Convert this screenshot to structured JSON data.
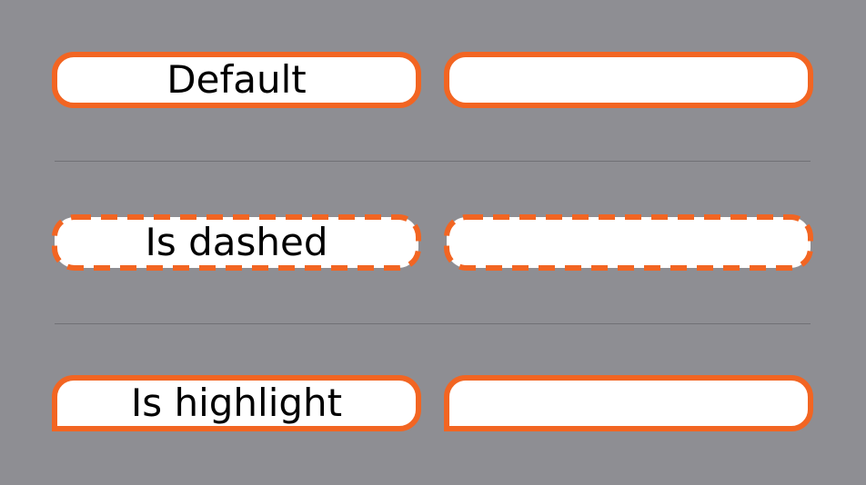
{
  "theme": {
    "background": "#8e8e93",
    "accent": "#f26522",
    "button_fill": "#ffffff",
    "text": "#000000",
    "divider": "#707075"
  },
  "rows": [
    {
      "label": "Default",
      "style": "solid"
    },
    {
      "label": "Is dashed",
      "style": "dashed"
    },
    {
      "label": "Is highlight",
      "style": "highlight"
    }
  ]
}
